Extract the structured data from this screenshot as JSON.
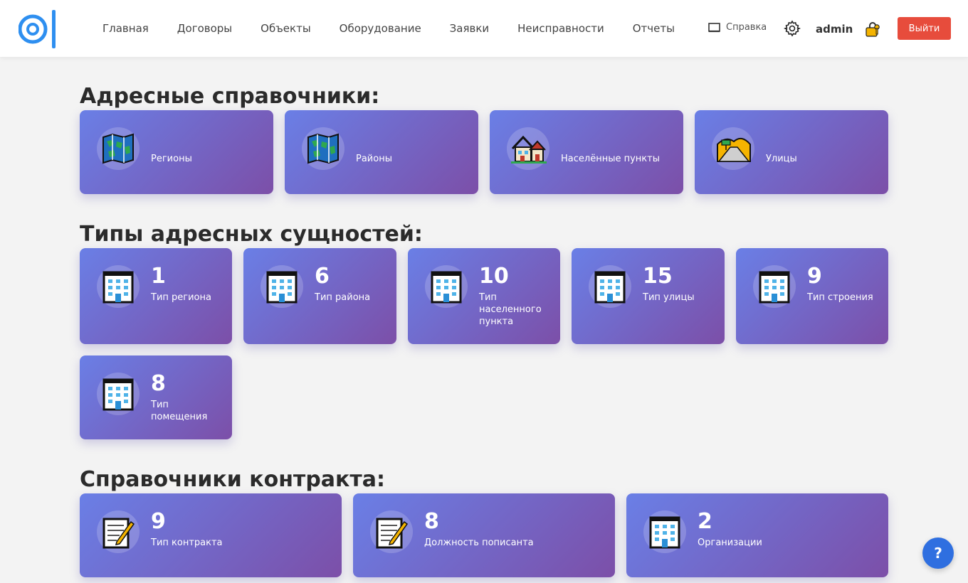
{
  "nav": [
    "Главная",
    "Договоры",
    "Объекты",
    "Оборудование",
    "Заявки",
    "Неисправности",
    "Отчеты"
  ],
  "header": {
    "help": "Справка",
    "user": "admin",
    "logout": "Выйти"
  },
  "sections": {
    "address": {
      "title": "Адресные справочники:",
      "cards": [
        {
          "label": "Регионы",
          "icon": "map-icon"
        },
        {
          "label": "Районы",
          "icon": "map-icon"
        },
        {
          "label": "Населённые пункты",
          "icon": "houses-icon"
        },
        {
          "label": "Улицы",
          "icon": "road-icon"
        }
      ]
    },
    "types": {
      "title": "Типы адресных сущностей:",
      "cards": [
        {
          "count": "1",
          "label": "Тип региона",
          "icon": "building-icon"
        },
        {
          "count": "6",
          "label": "Тип района",
          "icon": "building-icon"
        },
        {
          "count": "10",
          "label": "Тип населенного пункта",
          "icon": "building-icon"
        },
        {
          "count": "15",
          "label": "Тип улицы",
          "icon": "building-icon"
        },
        {
          "count": "9",
          "label": "Тип строения",
          "icon": "building-icon"
        },
        {
          "count": "8",
          "label": "Тип помещения",
          "icon": "building-icon"
        }
      ]
    },
    "contract": {
      "title": "Справочники контракта:",
      "cards": [
        {
          "count": "9",
          "label": "Тип контракта",
          "icon": "memo-icon"
        },
        {
          "count": "8",
          "label": "Должность пописанта",
          "icon": "memo-icon"
        },
        {
          "count": "2",
          "label": "Организации",
          "icon": "building-icon"
        }
      ]
    }
  },
  "help_fab": "?",
  "colors": {
    "card_start": "#6a7fe6",
    "card_end": "#7c4fa8",
    "logout": "#e74c3c",
    "logo": "#2e8ff0"
  }
}
